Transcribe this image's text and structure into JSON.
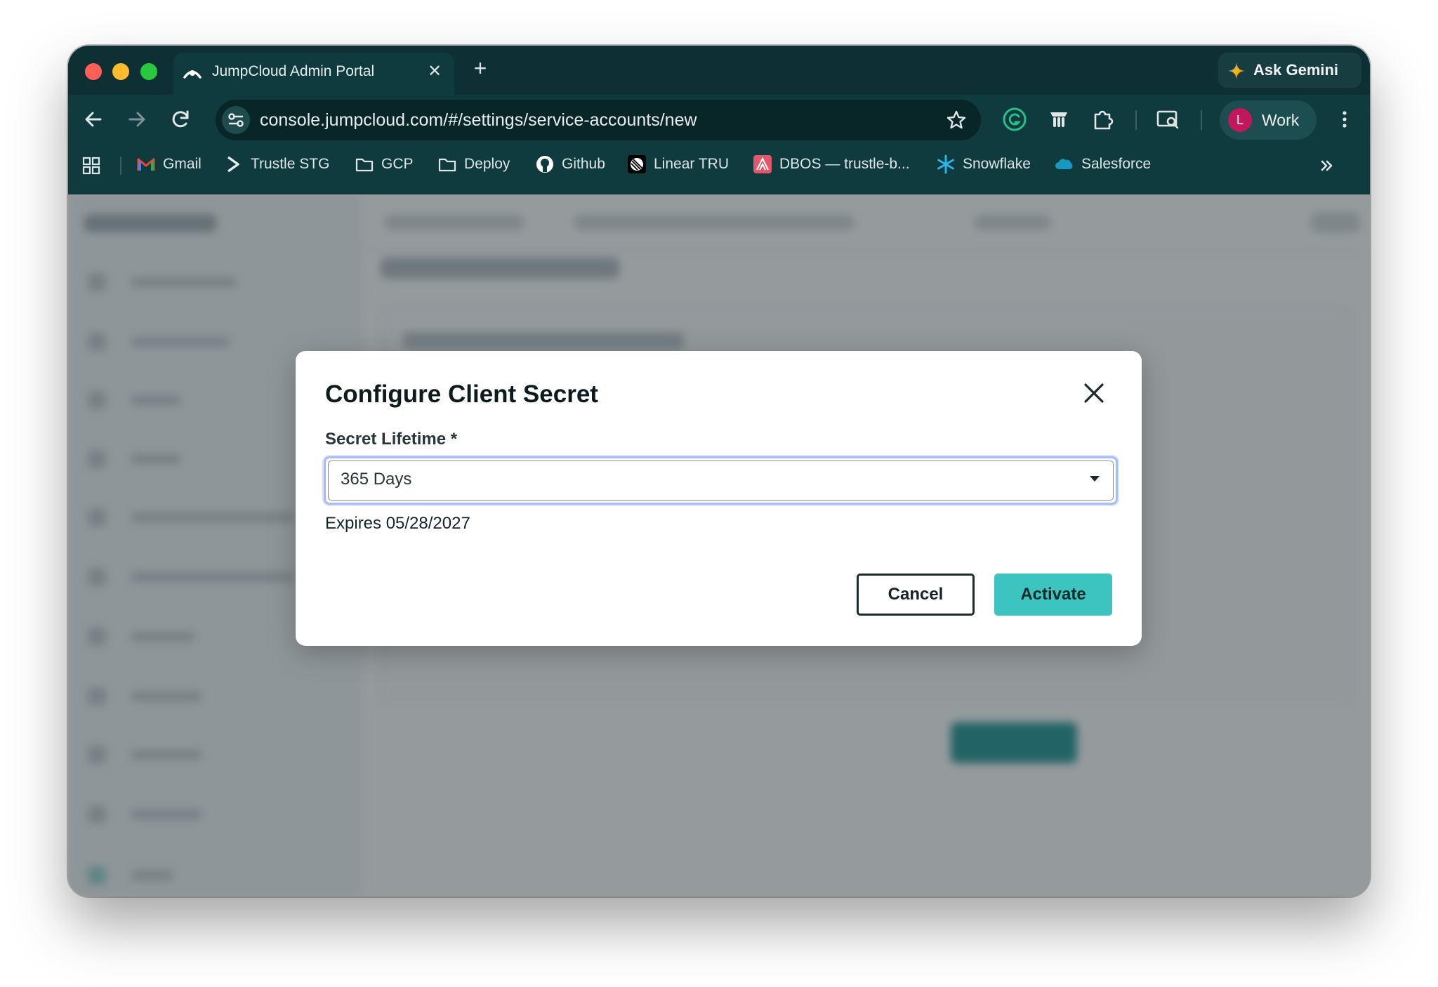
{
  "browser": {
    "tab": {
      "title": "JumpCloud Admin Portal",
      "close": "✕"
    },
    "new_tab": "+",
    "gemini": {
      "label": "Ask Gemini"
    },
    "url": "console.jumpcloud.com/#/settings/service-accounts/new",
    "profile": {
      "initial": "L",
      "label": "Work"
    },
    "bookmarks": [
      {
        "label": "Gmail",
        "icon": "gmail-icon"
      },
      {
        "label": "Trustle STG",
        "icon": "trustle-icon"
      },
      {
        "label": "GCP",
        "icon": "folder-icon"
      },
      {
        "label": "Deploy",
        "icon": "folder-icon"
      },
      {
        "label": "Github",
        "icon": "github-icon"
      },
      {
        "label": "Linear TRU",
        "icon": "linear-icon"
      },
      {
        "label": "DBOS — trustle-b...",
        "icon": "dbos-icon"
      },
      {
        "label": "Snowflake",
        "icon": "snowflake-icon"
      },
      {
        "label": "Salesforce",
        "icon": "salesforce-icon"
      }
    ]
  },
  "modal": {
    "title": "Configure Client Secret",
    "field_label": "Secret Lifetime *",
    "selected_value": "365 Days",
    "expires_text": "Expires 05/28/2027",
    "cancel_label": "Cancel",
    "activate_label": "Activate"
  },
  "colors": {
    "browser_chrome": "#0f3a3e",
    "accent_button": "#3cc5c0",
    "focus_ring": "#a6bdf6"
  }
}
